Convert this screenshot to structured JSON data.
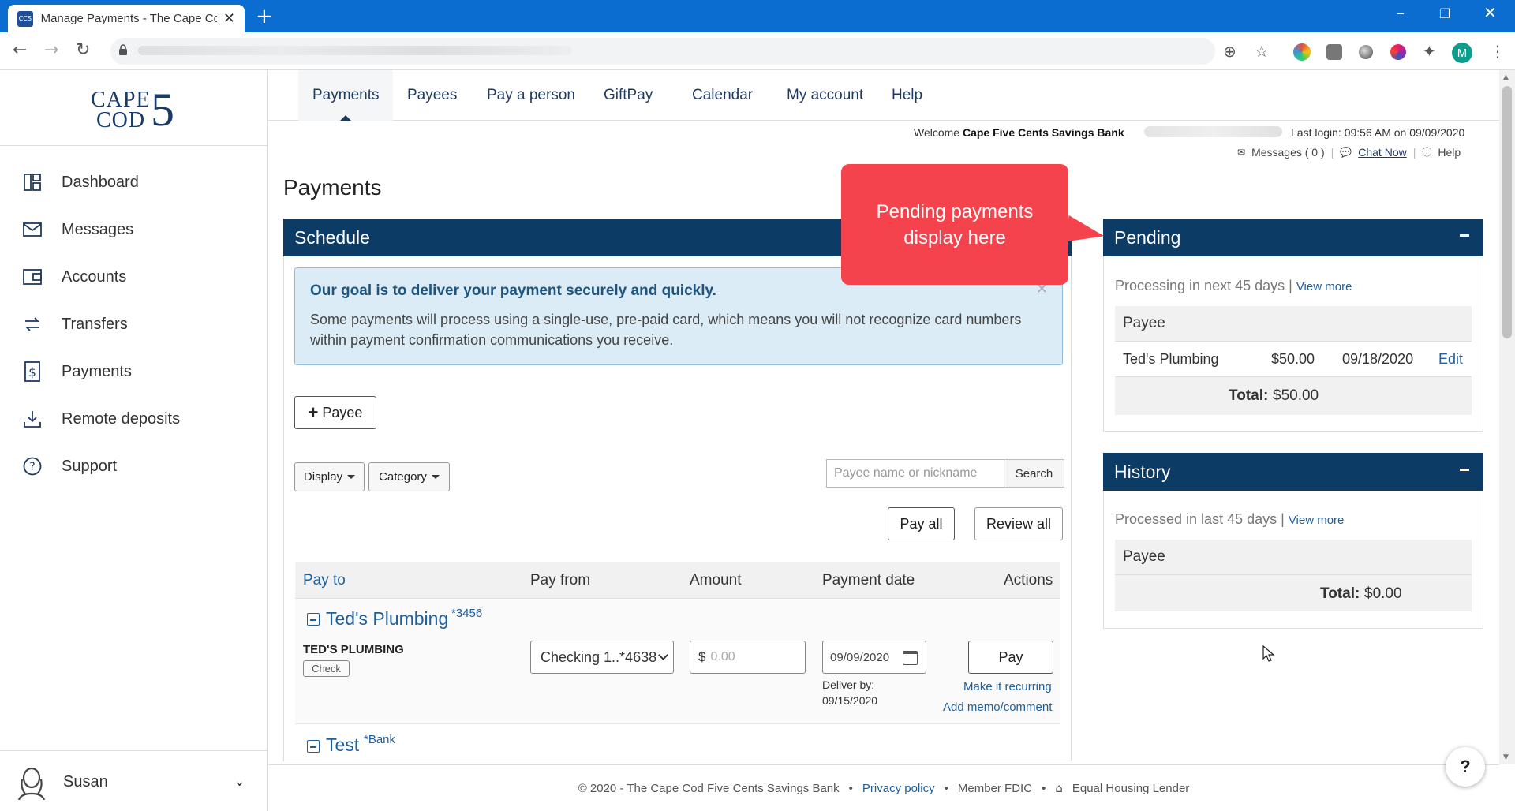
{
  "browser": {
    "tab_title": "Manage Payments - The Cape Co",
    "favicon_text": "CCS",
    "profile_initial": "M"
  },
  "sidebar": {
    "logo": {
      "line1": "CAPE",
      "line2": "COD",
      "numeral": "5"
    },
    "items": [
      {
        "label": "Dashboard",
        "icon": "dashboard-icon"
      },
      {
        "label": "Messages",
        "icon": "envelope-icon"
      },
      {
        "label": "Accounts",
        "icon": "wallet-icon"
      },
      {
        "label": "Transfers",
        "icon": "transfer-arrows-icon"
      },
      {
        "label": "Payments",
        "icon": "dollar-document-icon"
      },
      {
        "label": "Remote deposits",
        "icon": "download-tray-icon"
      },
      {
        "label": "Support",
        "icon": "question-circle-icon"
      }
    ],
    "user": {
      "name": "Susan"
    }
  },
  "topnav": {
    "items": [
      "Payments",
      "Payees",
      "Pay a person",
      "GiftPay",
      "Calendar",
      "My account",
      "Help"
    ],
    "active": "Payments"
  },
  "header": {
    "welcome_prefix": "Welcome",
    "welcome_name": "Cape Five Cents Savings Bank",
    "last_login": "Last login: 09:56 AM on 09/09/2020",
    "messages": "Messages ( 0 )",
    "chat": "Chat Now",
    "help": "Help",
    "sep": "|"
  },
  "page": {
    "title": "Payments"
  },
  "schedule": {
    "title": "Schedule",
    "alert_title": "Our goal is to deliver your payment securely and quickly.",
    "alert_text": "Some payments will process using a single-use, pre-paid card, which means you will not recognize card numbers within payment confirmation communications you receive.",
    "add_payee": "Payee",
    "display": "Display",
    "category": "Category",
    "search_placeholder": "Payee name or nickname",
    "search_button": "Search",
    "pay_all": "Pay all",
    "review_all": "Review all",
    "columns": [
      "Pay to",
      "Pay from",
      "Amount",
      "Payment date",
      "Actions"
    ],
    "payees": [
      {
        "name": "Ted's Plumbing",
        "suffix": "*3456",
        "caps": "TED'S PLUMBING",
        "method": "Check",
        "pay_from": "Checking 1..*4638",
        "currency": "$",
        "amount_placeholder": "0.00",
        "date": "09/09/2020",
        "deliver_label": "Deliver by:",
        "deliver_date": "09/15/2020",
        "pay": "Pay",
        "recurring": "Make it recurring",
        "memo": "Add memo/comment"
      },
      {
        "name": "Test",
        "suffix": "*Bank"
      }
    ]
  },
  "pending": {
    "title": "Pending",
    "subtitle": "Processing in next 45 days |",
    "view_more": "View more",
    "header": "Payee",
    "rows": [
      {
        "payee": "Ted's Plumbing",
        "amount": "$50.00",
        "date": "09/18/2020",
        "action": "Edit"
      }
    ],
    "total_label": "Total:",
    "total": "$50.00"
  },
  "history": {
    "title": "History",
    "subtitle": "Processed in last 45 days |",
    "view_more": "View more",
    "header": "Payee",
    "total_label": "Total:",
    "total": "$0.00"
  },
  "callout": {
    "text": "Pending payments display here"
  },
  "footer": {
    "copyright": "© 2020 - The Cape Cod Five Cents Savings Bank",
    "privacy": "Privacy policy",
    "fdic": "Member FDIC",
    "housing": "Equal Housing Lender",
    "dot": "•"
  },
  "help_fab": "?",
  "colors": {
    "brand_navy": "#0c3b66",
    "link_blue": "#1f5f9c",
    "callout_red": "#f4434c",
    "chrome_blue": "#0b6dcf"
  }
}
